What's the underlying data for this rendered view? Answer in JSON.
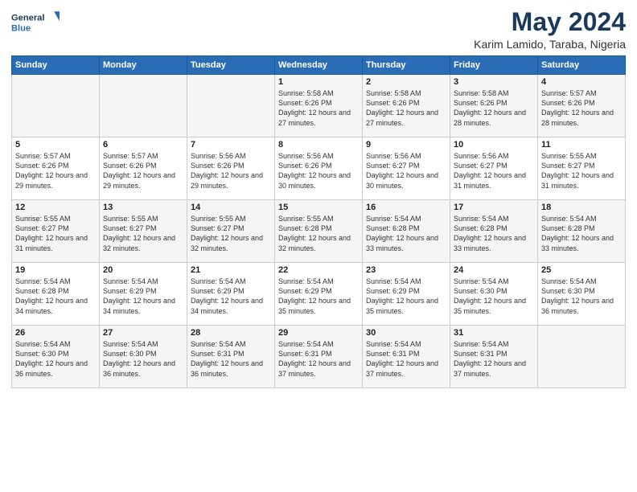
{
  "logo": {
    "line1": "General",
    "line2": "Blue"
  },
  "title": "May 2024",
  "subtitle": "Karim Lamido, Taraba, Nigeria",
  "days_of_week": [
    "Sunday",
    "Monday",
    "Tuesday",
    "Wednesday",
    "Thursday",
    "Friday",
    "Saturday"
  ],
  "weeks": [
    [
      {
        "day": "",
        "info": ""
      },
      {
        "day": "",
        "info": ""
      },
      {
        "day": "",
        "info": ""
      },
      {
        "day": "1",
        "info": "Sunrise: 5:58 AM\nSunset: 6:26 PM\nDaylight: 12 hours\nand 27 minutes."
      },
      {
        "day": "2",
        "info": "Sunrise: 5:58 AM\nSunset: 6:26 PM\nDaylight: 12 hours\nand 27 minutes."
      },
      {
        "day": "3",
        "info": "Sunrise: 5:58 AM\nSunset: 6:26 PM\nDaylight: 12 hours\nand 28 minutes."
      },
      {
        "day": "4",
        "info": "Sunrise: 5:57 AM\nSunset: 6:26 PM\nDaylight: 12 hours\nand 28 minutes."
      }
    ],
    [
      {
        "day": "5",
        "info": "Sunrise: 5:57 AM\nSunset: 6:26 PM\nDaylight: 12 hours\nand 29 minutes."
      },
      {
        "day": "6",
        "info": "Sunrise: 5:57 AM\nSunset: 6:26 PM\nDaylight: 12 hours\nand 29 minutes."
      },
      {
        "day": "7",
        "info": "Sunrise: 5:56 AM\nSunset: 6:26 PM\nDaylight: 12 hours\nand 29 minutes."
      },
      {
        "day": "8",
        "info": "Sunrise: 5:56 AM\nSunset: 6:26 PM\nDaylight: 12 hours\nand 30 minutes."
      },
      {
        "day": "9",
        "info": "Sunrise: 5:56 AM\nSunset: 6:27 PM\nDaylight: 12 hours\nand 30 minutes."
      },
      {
        "day": "10",
        "info": "Sunrise: 5:56 AM\nSunset: 6:27 PM\nDaylight: 12 hours\nand 31 minutes."
      },
      {
        "day": "11",
        "info": "Sunrise: 5:55 AM\nSunset: 6:27 PM\nDaylight: 12 hours\nand 31 minutes."
      }
    ],
    [
      {
        "day": "12",
        "info": "Sunrise: 5:55 AM\nSunset: 6:27 PM\nDaylight: 12 hours\nand 31 minutes."
      },
      {
        "day": "13",
        "info": "Sunrise: 5:55 AM\nSunset: 6:27 PM\nDaylight: 12 hours\nand 32 minutes."
      },
      {
        "day": "14",
        "info": "Sunrise: 5:55 AM\nSunset: 6:27 PM\nDaylight: 12 hours\nand 32 minutes."
      },
      {
        "day": "15",
        "info": "Sunrise: 5:55 AM\nSunset: 6:28 PM\nDaylight: 12 hours\nand 32 minutes."
      },
      {
        "day": "16",
        "info": "Sunrise: 5:54 AM\nSunset: 6:28 PM\nDaylight: 12 hours\nand 33 minutes."
      },
      {
        "day": "17",
        "info": "Sunrise: 5:54 AM\nSunset: 6:28 PM\nDaylight: 12 hours\nand 33 minutes."
      },
      {
        "day": "18",
        "info": "Sunrise: 5:54 AM\nSunset: 6:28 PM\nDaylight: 12 hours\nand 33 minutes."
      }
    ],
    [
      {
        "day": "19",
        "info": "Sunrise: 5:54 AM\nSunset: 6:28 PM\nDaylight: 12 hours\nand 34 minutes."
      },
      {
        "day": "20",
        "info": "Sunrise: 5:54 AM\nSunset: 6:29 PM\nDaylight: 12 hours\nand 34 minutes."
      },
      {
        "day": "21",
        "info": "Sunrise: 5:54 AM\nSunset: 6:29 PM\nDaylight: 12 hours\nand 34 minutes."
      },
      {
        "day": "22",
        "info": "Sunrise: 5:54 AM\nSunset: 6:29 PM\nDaylight: 12 hours\nand 35 minutes."
      },
      {
        "day": "23",
        "info": "Sunrise: 5:54 AM\nSunset: 6:29 PM\nDaylight: 12 hours\nand 35 minutes."
      },
      {
        "day": "24",
        "info": "Sunrise: 5:54 AM\nSunset: 6:30 PM\nDaylight: 12 hours\nand 35 minutes."
      },
      {
        "day": "25",
        "info": "Sunrise: 5:54 AM\nSunset: 6:30 PM\nDaylight: 12 hours\nand 36 minutes."
      }
    ],
    [
      {
        "day": "26",
        "info": "Sunrise: 5:54 AM\nSunset: 6:30 PM\nDaylight: 12 hours\nand 36 minutes."
      },
      {
        "day": "27",
        "info": "Sunrise: 5:54 AM\nSunset: 6:30 PM\nDaylight: 12 hours\nand 36 minutes."
      },
      {
        "day": "28",
        "info": "Sunrise: 5:54 AM\nSunset: 6:31 PM\nDaylight: 12 hours\nand 36 minutes."
      },
      {
        "day": "29",
        "info": "Sunrise: 5:54 AM\nSunset: 6:31 PM\nDaylight: 12 hours\nand 37 minutes."
      },
      {
        "day": "30",
        "info": "Sunrise: 5:54 AM\nSunset: 6:31 PM\nDaylight: 12 hours\nand 37 minutes."
      },
      {
        "day": "31",
        "info": "Sunrise: 5:54 AM\nSunset: 6:31 PM\nDaylight: 12 hours\nand 37 minutes."
      },
      {
        "day": "",
        "info": ""
      }
    ]
  ]
}
